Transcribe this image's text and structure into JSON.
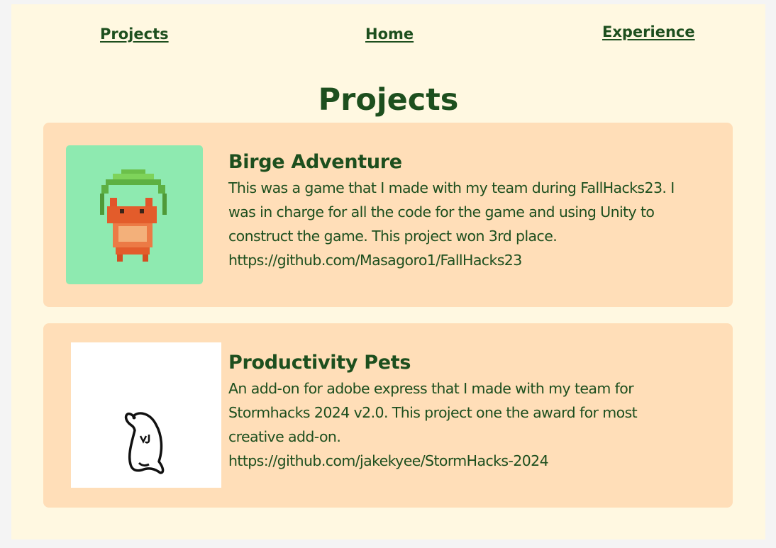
{
  "nav": {
    "projects": "Projects",
    "home": "Home",
    "experience": "Experience"
  },
  "page_title": "Projects",
  "projects": [
    {
      "title": "Birge Adventure",
      "description": "This was a game that I made with my team during FallHacks23. I was in charge for all the code for the game and using Unity to construct the game. This project won 3rd place.",
      "link": "https://github.com/Masagoro1/FallHacks23",
      "image": "pixel-fox-icon"
    },
    {
      "title": "Productivity Pets",
      "description": "An add-on for adobe express that I made with my team for Stormhacks 2024 v2.0. This project one the award for most creative add-on.",
      "link": "https://github.com/jakekyee/StormHacks-2024",
      "image": "doodle-pet-icon"
    }
  ],
  "colors": {
    "background": "#fff8e1",
    "card": "#ffdeb8",
    "text": "#1d4f1e",
    "thumb1": "#8eeab0"
  }
}
